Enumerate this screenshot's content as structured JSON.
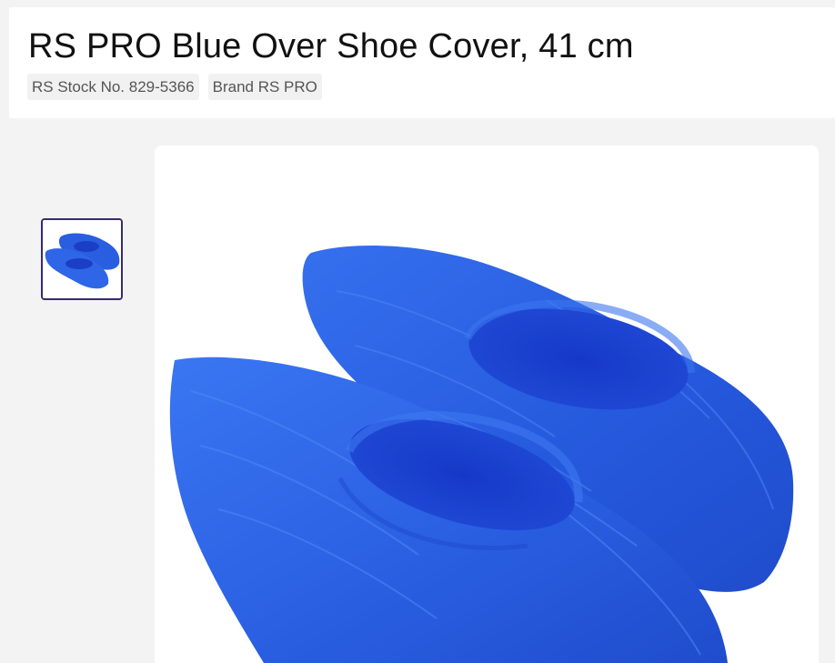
{
  "product": {
    "title": "RS PRO Blue Over Shoe Cover, 41 cm",
    "stock_no": "RS Stock No. 829-5366",
    "brand": "Brand RS PRO"
  },
  "gallery": {
    "thumbnails": [
      {
        "name": "shoe-cover-thumbnail",
        "selected": true
      }
    ],
    "main_image": "blue-shoe-covers-photo"
  },
  "colors": {
    "page_bg": "#f3f3f3",
    "card_bg": "#ffffff",
    "thumb_border": "#3a2a6a",
    "product_blue": "#2a5ee0",
    "product_blue_dark": "#1b3fc4"
  }
}
